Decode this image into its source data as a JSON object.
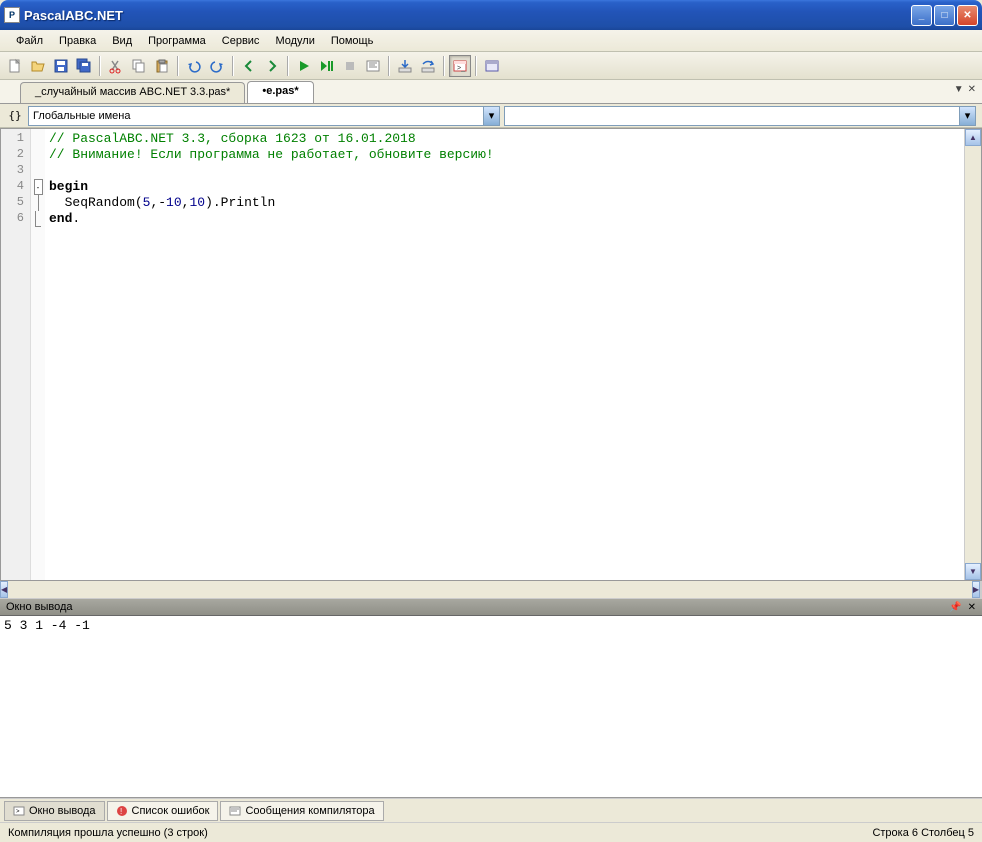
{
  "window": {
    "title": "PascalABC.NET"
  },
  "menu": {
    "file": "Файл",
    "edit": "Правка",
    "view": "Вид",
    "program": "Программа",
    "service": "Сервис",
    "modules": "Модули",
    "help": "Помощь"
  },
  "tabs": [
    {
      "label": "_случайный массив ABC.NET 3.3.pas*"
    },
    {
      "label": "•e.pas*"
    }
  ],
  "combo": {
    "braces": "{}",
    "text": "Глобальные имена"
  },
  "code": {
    "lines": [
      "1",
      "2",
      "3",
      "4",
      "5",
      "6"
    ],
    "l1": "// PascalABC.NET 3.3, сборка 1623 от 16.01.2018",
    "l2": "// Внимание! Если программа не работает, обновите версию!",
    "l3": "",
    "l4a": "begin",
    "l5a": "  SeqRandom(",
    "l5b": "5",
    "l5c": ",-",
    "l5d": "10",
    "l5e": ",",
    "l5f": "10",
    "l5g": ").Println",
    "l6a": "end",
    "l6b": "."
  },
  "output": {
    "title": "Окно вывода",
    "text": "5 3 1 -4 -1"
  },
  "bottom_tabs": {
    "out": "Окно вывода",
    "errors": "Список ошибок",
    "compiler": "Сообщения компилятора"
  },
  "status": {
    "left": "Компиляция прошла успешно (3 строк)",
    "right": "Строка  6  Столбец  5"
  }
}
